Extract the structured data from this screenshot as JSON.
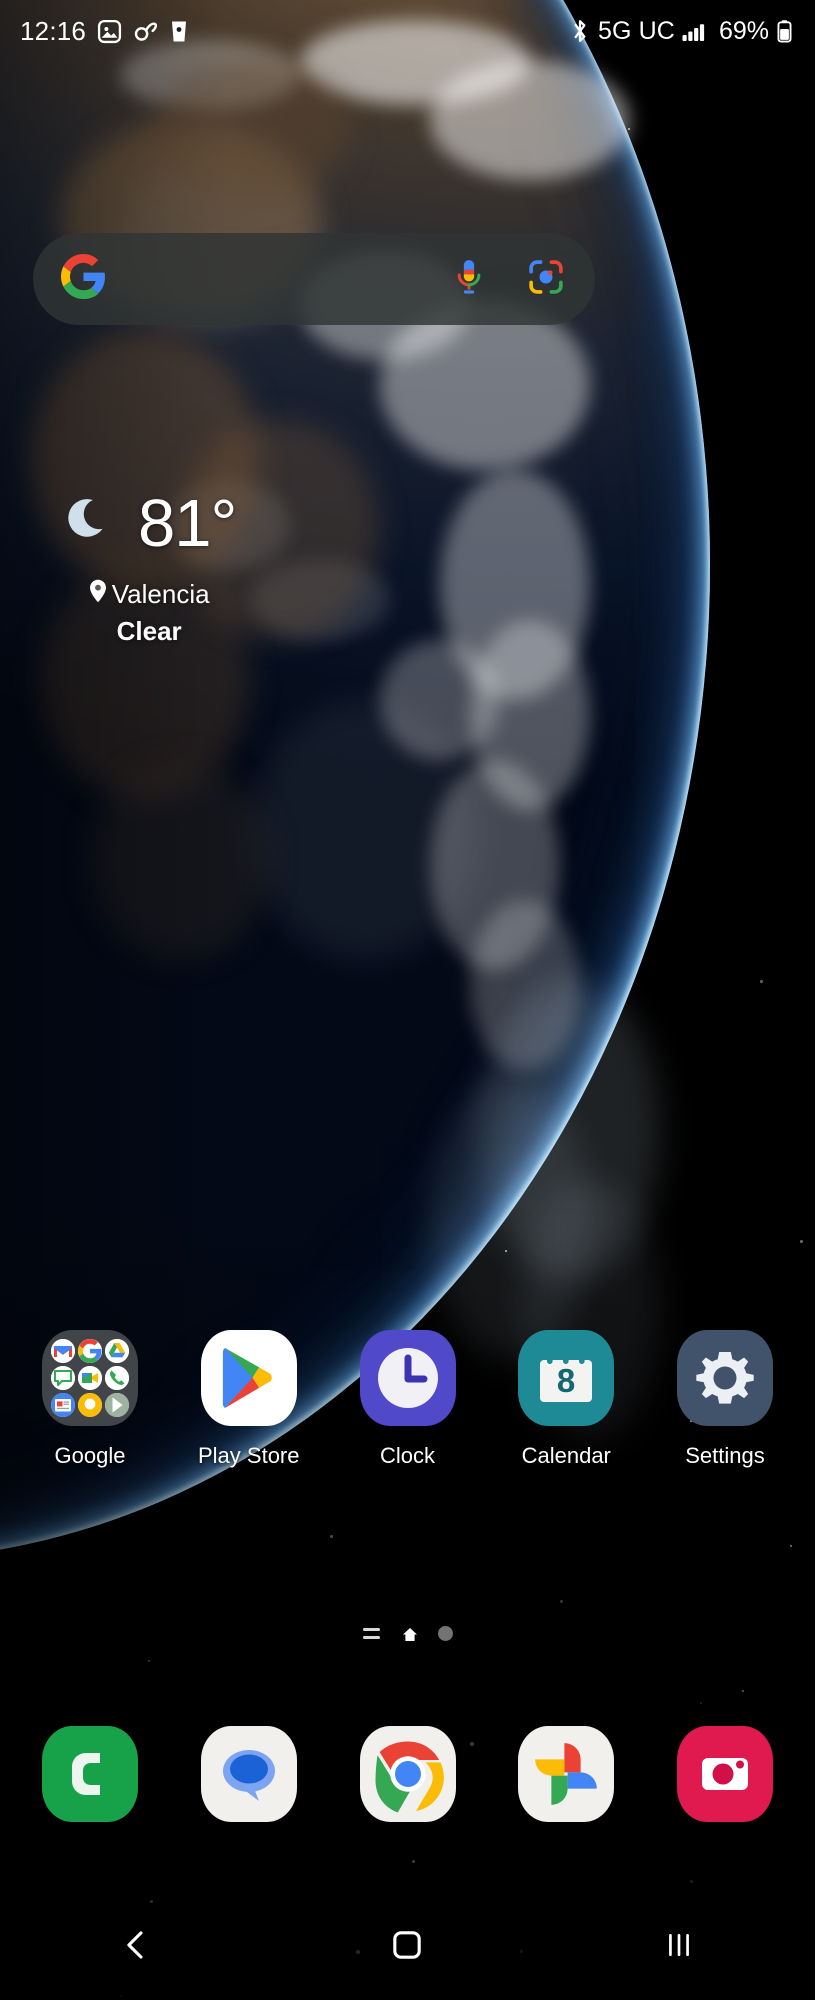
{
  "status_bar": {
    "time": "12:16",
    "left_icons": [
      {
        "name": "image-icon",
        "label": "Screenshot"
      },
      {
        "name": "link-icon",
        "label": "Link"
      },
      {
        "name": "coffee-cup-icon",
        "label": "Coffee"
      }
    ],
    "bluetooth_icon": "bluetooth-icon",
    "network_label": "5G UC",
    "signal_icon": "signal-bars-icon",
    "battery_percent": "69%",
    "battery_icon": "battery-icon"
  },
  "search": {
    "placeholder": "",
    "value": "",
    "google_logo": "google-g-icon",
    "mic_icon": "microphone-icon",
    "lens_icon": "google-lens-icon"
  },
  "weather": {
    "condition_icon": "crescent-moon-icon",
    "temperature": "81°",
    "location_icon": "location-pin-icon",
    "location": "Valencia",
    "condition": "Clear"
  },
  "apps": [
    {
      "label": "Google",
      "icon": "google-folder-icon",
      "type": "folder",
      "folder_items": [
        "gmail-icon",
        "google-search-icon",
        "google-drive-icon",
        "google-chat-icon",
        "google-meet-icon",
        "google-phone-icon",
        "google-news-icon",
        "google-assistant-icon",
        "google-play-icon"
      ]
    },
    {
      "label": "Play Store",
      "icon": "play-store-icon",
      "type": "app"
    },
    {
      "label": "Clock",
      "icon": "clock-icon",
      "type": "app"
    },
    {
      "label": "Calendar",
      "icon": "calendar-icon",
      "type": "app",
      "badge": "8"
    },
    {
      "label": "Settings",
      "icon": "settings-gear-icon",
      "type": "app"
    }
  ],
  "page_indicator": {
    "apps_button": "app-list-icon",
    "home_button": "home-page-icon",
    "next_page_dot": "page-dot-icon",
    "current_page": 1,
    "total_pages": 2
  },
  "dock": [
    {
      "label": "Phone",
      "icon": "phone-icon"
    },
    {
      "label": "Messages",
      "icon": "messages-icon"
    },
    {
      "label": "Chrome",
      "icon": "chrome-icon"
    },
    {
      "label": "Photos",
      "icon": "google-photos-icon"
    },
    {
      "label": "Camera",
      "icon": "camera-icon"
    }
  ],
  "nav_bar": [
    {
      "label": "Back",
      "icon": "back-chevron-icon"
    },
    {
      "label": "Home",
      "icon": "home-square-icon"
    },
    {
      "label": "Recents",
      "icon": "recents-bars-icon"
    }
  ],
  "colors": {
    "search_bar_bg": "#303535",
    "clock_app": "#5049c9",
    "calendar_app": "#1e8a96",
    "settings_app": "#41526b",
    "phone_app": "#17a24a",
    "camera_app": "#e0194f",
    "google_blue": "#4285f4",
    "google_red": "#ea4335",
    "google_yellow": "#fbbc05",
    "google_green": "#34a853"
  }
}
